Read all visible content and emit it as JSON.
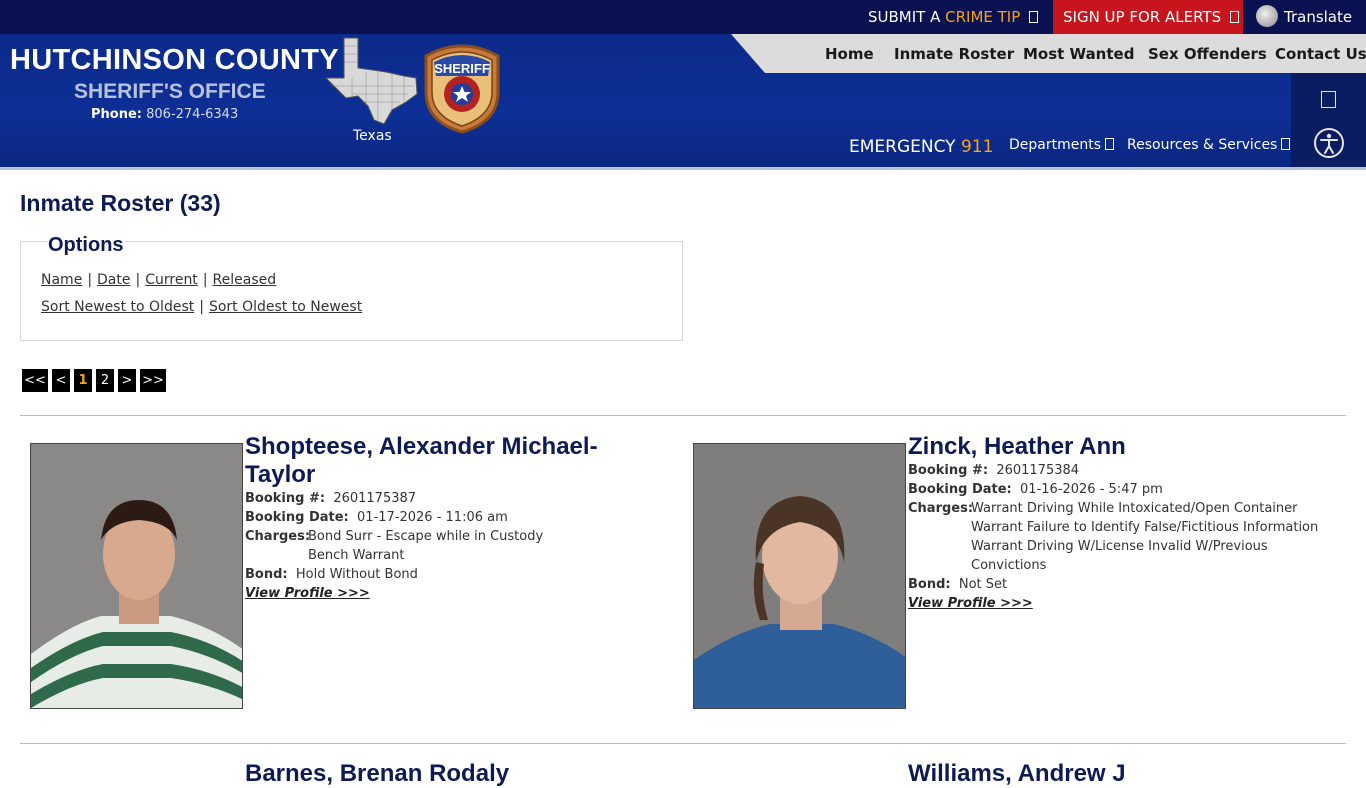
{
  "topbar": {
    "crime_tip_a": "SUBMIT A",
    "crime_tip_b": "CRIME TIP",
    "alerts": "SIGN UP FOR ALERTS",
    "translate": "Translate"
  },
  "brand": {
    "title": "HUTCHINSON COUNTY",
    "subtitle": "SHERIFF'S OFFICE",
    "phone_label": "Phone:",
    "phone": "806-274-6343",
    "map_label": "Texas",
    "badge_text": "SHERIFF"
  },
  "nav": {
    "items": [
      "Home",
      "Inmate Roster",
      "Most Wanted",
      "Sex Offenders",
      "Contact Us"
    ]
  },
  "emergency": {
    "label": "EMERGENCY",
    "number": "911"
  },
  "dropdowns": [
    "Departments",
    "Resources & Services"
  ],
  "page": {
    "title": "Inmate Roster (33)"
  },
  "options": {
    "title": "Options",
    "filters": [
      "Name",
      "Date",
      "Current",
      "Released"
    ],
    "sorts": [
      "Sort Newest to Oldest",
      "Sort Oldest to Newest"
    ],
    "sep": "|"
  },
  "pager": [
    "<<",
    "<",
    "1",
    "2",
    ">",
    ">>"
  ],
  "labels": {
    "booking_no": "Booking #:",
    "booking_date": "Booking Date:",
    "charges": "Charges:",
    "bond": "Bond:",
    "view_profile": "View Profile >>>"
  },
  "inmates": [
    {
      "name_line1": "Shopteese, Alexander Michael-",
      "name_line2": "Taylor",
      "booking_no": "2601175387",
      "booking_date": "01-17-2026 - 11:06 am",
      "charges": [
        "Bond Surr - Escape while in Custody",
        "Bench Warrant"
      ],
      "bond": "Hold Without Bond"
    },
    {
      "name_line1": "Zinck, Heather Ann",
      "booking_no": "2601175384",
      "booking_date": "01-16-2026 - 5:47 pm",
      "charges": [
        "Warrant Driving While Intoxicated/Open Container",
        "Warrant Failure to Identify False/Fictitious Information",
        "Warrant Driving W/License Invalid W/Previous",
        "Convictions"
      ],
      "bond": "Not Set"
    }
  ],
  "next_row": {
    "left_name": "Barnes, Brenan Rodaly",
    "right_name": "Williams, Andrew J"
  },
  "colors": {
    "navy": "#0a1150",
    "header_blue": "#0d2f96",
    "alert_red": "#c8141c",
    "accent_orange": "#f2a51a"
  }
}
